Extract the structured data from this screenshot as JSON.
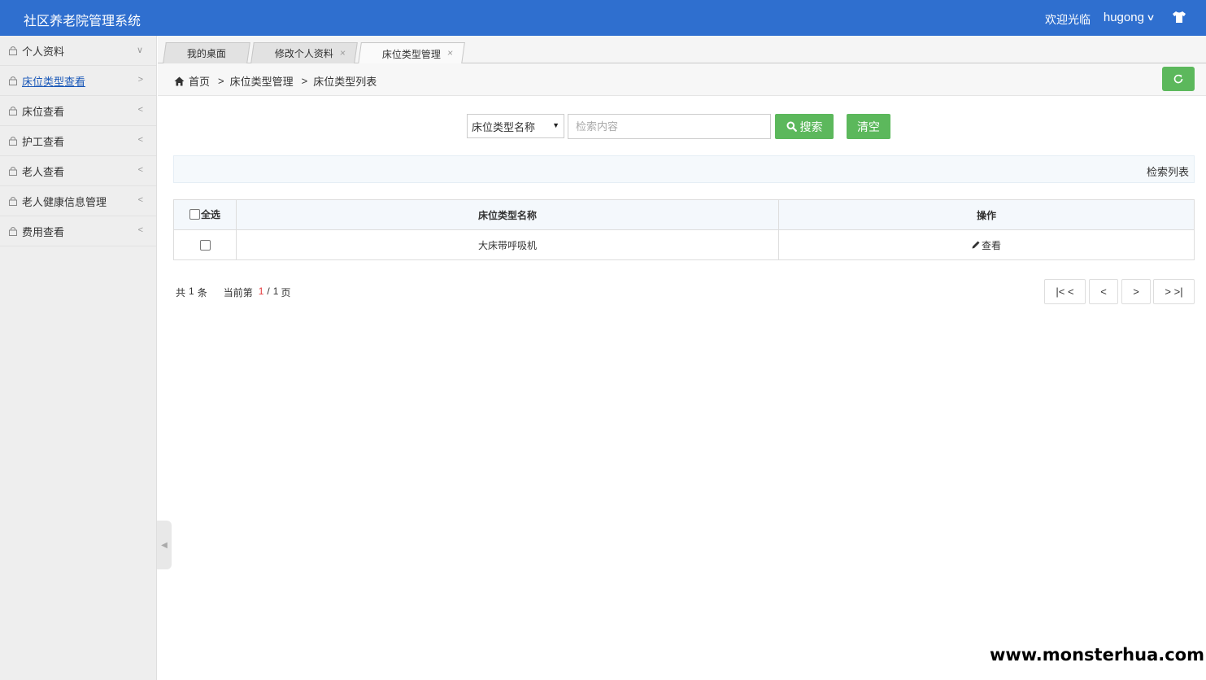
{
  "header": {
    "title": "社区养老院管理系统",
    "welcome": "欢迎光临",
    "username": "hugong",
    "chevron": "∨"
  },
  "colors": {
    "primary": "#2f6fcf",
    "accent_green": "#5cb85c",
    "page_current": "#e4393c"
  },
  "sidebar": {
    "items": [
      {
        "label": "个人资料",
        "arrow": "∨",
        "icon": "lock-icon"
      },
      {
        "label": "床位类型查看",
        "arrow": ">",
        "icon": "lock-icon",
        "active": true
      },
      {
        "label": "床位查看",
        "arrow": "<",
        "icon": "lock-icon"
      },
      {
        "label": "护工查看",
        "arrow": "<",
        "icon": "lock-icon"
      },
      {
        "label": "老人查看",
        "arrow": "<",
        "icon": "lock-icon"
      },
      {
        "label": "老人健康信息管理",
        "arrow": "<",
        "icon": "lock-icon"
      },
      {
        "label": "费用查看",
        "arrow": "<",
        "icon": "lock-icon"
      }
    ],
    "collapse_glyph": "◀"
  },
  "tabs": [
    {
      "label": "我的桌面",
      "closable": false
    },
    {
      "label": "修改个人资料",
      "closable": true,
      "close": "×"
    },
    {
      "label": "床位类型管理",
      "closable": true,
      "close": "×",
      "active": true
    }
  ],
  "breadcrumb": {
    "home": "首页",
    "sep": ">",
    "level1": "床位类型管理",
    "level2": "床位类型列表"
  },
  "search": {
    "field_selected": "床位类型名称",
    "placeholder": "检索内容",
    "search_label": "搜索",
    "clear_label": "清空"
  },
  "result_title": "检索列表",
  "table": {
    "headers": {
      "select_all": "全选",
      "name": "床位类型名称",
      "actions": "操作"
    },
    "rows": [
      {
        "name": "大床带呼吸机",
        "action": "查看"
      }
    ]
  },
  "pagination": {
    "total_prefix": "共",
    "total": "1",
    "total_suffix": "条",
    "current_prefix": "当前第",
    "current": "1",
    "sep": "/",
    "pages": "1",
    "pages_suffix": "页",
    "first": "|< <",
    "prev": "<",
    "next": ">",
    "last": "> >|"
  },
  "watermark": "www.monsterhua.com"
}
